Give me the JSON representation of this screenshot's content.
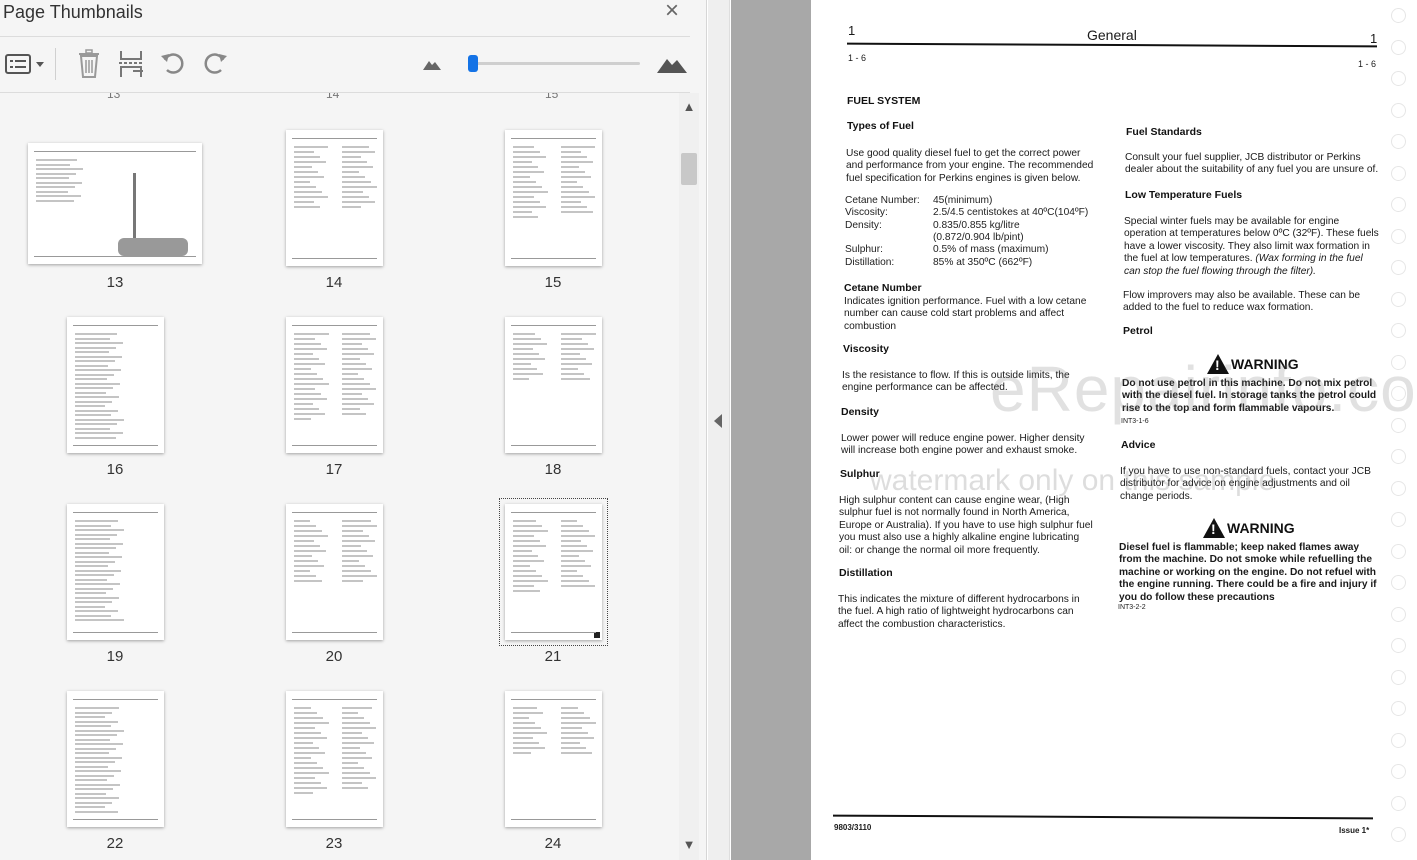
{
  "panel": {
    "title": "Page Thumbnails",
    "close_icon": "×",
    "toolbar": {
      "options_icon": "list-options-icon",
      "delete_icon": "trash-icon",
      "insert_icon": "insert-page-icon",
      "undo_icon": "undo-icon",
      "redo_icon": "redo-icon",
      "zoom_out_icon": "small-mountain-icon",
      "zoom_in_icon": "large-mountain-icon",
      "zoom_level": 0.02
    },
    "prev_row_numbers": [
      "13",
      "14",
      "15"
    ],
    "thumbnails": [
      {
        "num": "13"
      },
      {
        "num": "14"
      },
      {
        "num": "15"
      },
      {
        "num": "16"
      },
      {
        "num": "17"
      },
      {
        "num": "18"
      },
      {
        "num": "19"
      },
      {
        "num": "20"
      },
      {
        "num": "21"
      },
      {
        "num": "22"
      },
      {
        "num": "23"
      },
      {
        "num": "24"
      }
    ],
    "selected_page": "21"
  },
  "doc": {
    "header_left_num": "1",
    "header_title": "General",
    "header_right_num": "1",
    "page_left": "1 - 6",
    "page_right": "1 - 6",
    "fuel_system": "FUEL SYSTEM",
    "types_of_fuel": "Types of Fuel",
    "types_of_fuel_text": "Use good quality diesel fuel to get the correct power and performance from your engine. The recommended fuel specification for Perkins engines is given below.",
    "specs": [
      {
        "label": "Cetane Number:",
        "value": "45(minimum)"
      },
      {
        "label": "Viscosity:",
        "value": "2.5/4.5 centistokes at 40ºC(104ºF)"
      },
      {
        "label": "Density:",
        "value": "0.835/0.855 kg/litre"
      },
      {
        "label": "",
        "value": "(0.872/0.904 lb/pint)"
      },
      {
        "label": "Sulphur:",
        "value": "0.5% of mass (maximum)"
      },
      {
        "label": "Distillation:",
        "value": "85% at 350ºC (662ºF)"
      }
    ],
    "cetane_h": "Cetane Number",
    "cetane_t": "Indicates ignition performance. Fuel with a low cetane number can cause cold start problems and affect combustion",
    "viscosity_h": "Viscosity",
    "viscosity_t": "Is the resistance to flow. If this is outside limits, the engine performance can be affected.",
    "density_h": "Density",
    "density_t": "Lower power will reduce engine power. Higher density will increase both engine power and exhaust smoke.",
    "sulphur_h": "Sulphur",
    "sulphur_t": "High sulphur content can cause engine wear, (High sulphur fuel is not normally found in North America, Europe or Australia). If you have to use high sulphur fuel you must also use a highly alkaline engine lubricating oil: or change the normal oil more frequently.",
    "distillation_h": "Distillation",
    "distillation_t": "This indicates the mixture of different hydrocarbons in the fuel. A high ratio of lightweight hydrocarbons can affect the combustion characteristics.",
    "fuel_std_h": "Fuel Standards",
    "fuel_std_t": "Consult your fuel supplier, JCB distributor or Perkins dealer about the suitability of any fuel you are unsure of.",
    "low_temp_h": "Low Temperature Fuels",
    "low_temp_t": "Special winter fuels may be available for engine operation at temperatures below 0ºC (32ºF). These fuels have a lower viscosity. They also limit wax formation in the fuel at low temperatures.",
    "low_temp_i": "(Wax forming in the fuel can stop the fuel flowing through the filter).",
    "flow_t": "Flow improvers may also be available. These can be added to the fuel to reduce wax formation.",
    "petrol_h": "Petrol",
    "warning_label": "WARNING",
    "warn1_t": "Do not use petrol in this machine. Do not mix petrol with the diesel fuel. In storage tanks the petrol could rise to the top and form flammable vapours.",
    "warn1_code": "INT3-1-6",
    "advice_h": "Advice",
    "advice_t": "If you have to use non-standard fuels, contact your JCB distributor for advice on engine adjustments and oil change periods.",
    "warn2_t": "Diesel fuel is flammable; keep naked flames away from the machine. Do not smoke while refuelling the machine or working on the engine. Do not refuel with the engine running. There could be a fire and injury if you do follow these precautions",
    "warn2_code": "INT3-2-2",
    "footer_left": "9803/3110",
    "footer_right": "Issue 1*",
    "watermark_main": "eRepairinfo.com",
    "watermark_sub": "watermark only on this sample"
  }
}
